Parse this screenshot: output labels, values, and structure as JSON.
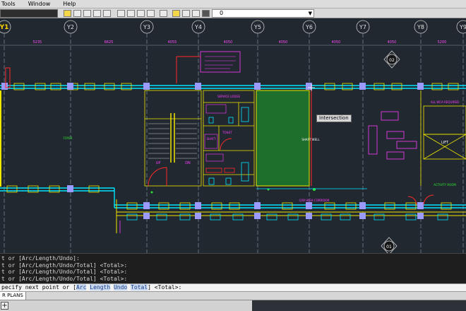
{
  "menu": {
    "items": [
      "Tools",
      "Window",
      "Help"
    ]
  },
  "layer": {
    "current": "0"
  },
  "axes": {
    "top": [
      "Y1",
      "Y2",
      "Y3",
      "Y4",
      "Y5",
      "Y6",
      "Y7",
      "Y8",
      "Y9"
    ],
    "dims": [
      "5235",
      "6625",
      "4055",
      "4050",
      "4050",
      "4050",
      "4050",
      "5200"
    ],
    "markers": [
      "02",
      "01"
    ]
  },
  "tooltip": "Intersection",
  "room_labels": {
    "service_lodge": "SERVICE LODGE",
    "toilet": "TOILET",
    "shaft": "SHAFT",
    "corridor": "G/W HIGH CORRIDOR",
    "up": "UP",
    "dn": "DN",
    "lift": "LIFT",
    "activity_room": "ACTIVITY ROOM"
  },
  "command": {
    "lines": [
      "t or [Arc/Length/Undo]:",
      "t or [Arc/Length/Undo/Total] <Total>:",
      "t or [Arc/Length/Undo/Total] <Total>:",
      "t or [Arc/Length/Undo/Total] <Total>:"
    ],
    "prompt_prefix": "pecify next point or [",
    "options": [
      "Arc",
      "Length",
      "Undo",
      "Total"
    ],
    "prompt_suffix": "] <Total>:"
  },
  "tabs": {
    "current": "R PLANS"
  },
  "colors": {
    "background": "#212830",
    "grid": "#7f8fa0",
    "cyan": "#00e6ff",
    "yellow": "#f0e600",
    "magenta": "#ff3cff",
    "green": "#2ee62e",
    "red": "#ff2a2a",
    "shaft_fill": "#1e6e2c"
  }
}
